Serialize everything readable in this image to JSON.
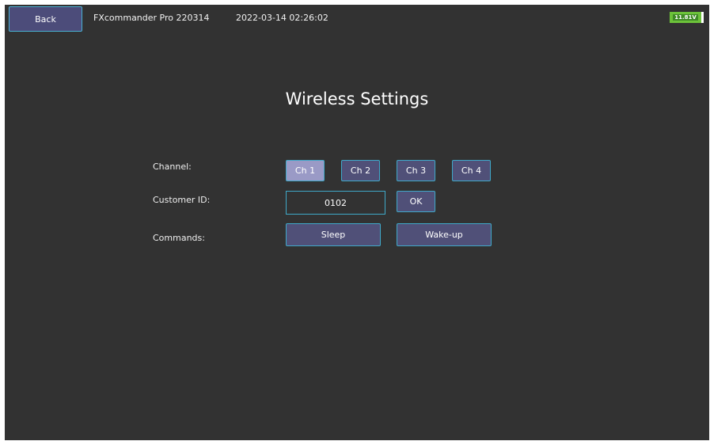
{
  "header": {
    "back_label": "Back",
    "app_title": "FXcommander Pro 220314",
    "datetime": "2022-03-14 02:26:02",
    "battery_voltage": "11.81V"
  },
  "main": {
    "title": "Wireless Settings",
    "channel": {
      "label": "Channel:",
      "options": [
        "Ch 1",
        "Ch 2",
        "Ch 3",
        "Ch 4"
      ],
      "selected": "Ch 1"
    },
    "customer_id": {
      "label": "Customer ID:",
      "value": "0102",
      "ok_label": "OK"
    },
    "commands": {
      "label": "Commands:",
      "sleep_label": "Sleep",
      "wakeup_label": "Wake-up"
    }
  },
  "colors": {
    "background": "#323232",
    "button_fill": "#505078",
    "button_selected_fill": "#9a9ac6",
    "button_border": "#3fa9c9",
    "battery": "#6cc23a"
  }
}
